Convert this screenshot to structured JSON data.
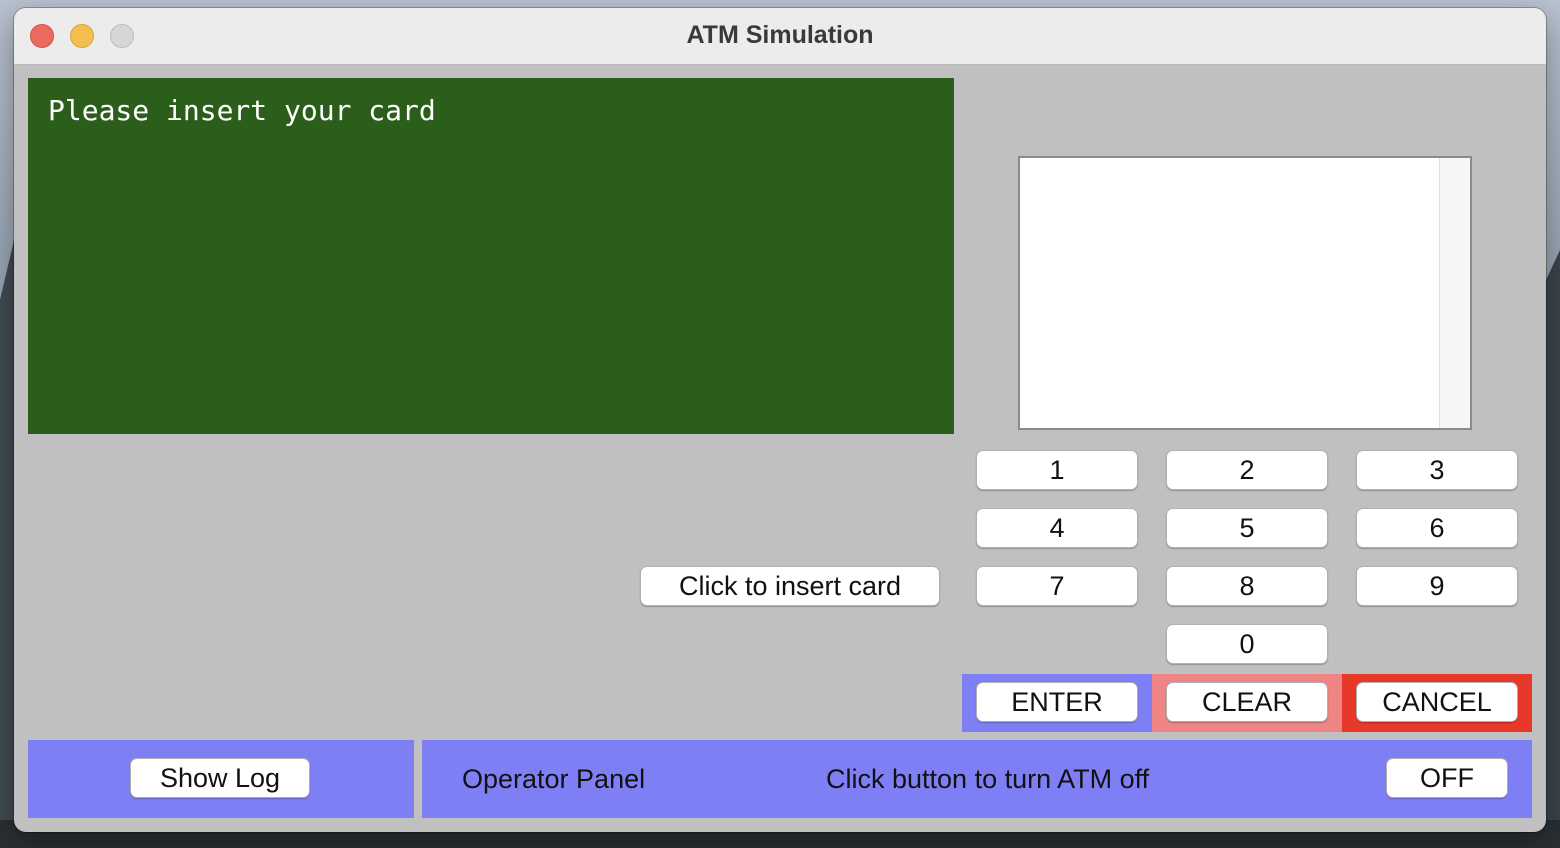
{
  "window": {
    "title": "ATM Simulation"
  },
  "display": {
    "message": "Please insert your card"
  },
  "card_slot": {
    "button_label": "Click to insert card"
  },
  "keypad": {
    "keys": [
      "1",
      "2",
      "3",
      "4",
      "5",
      "6",
      "7",
      "8",
      "9",
      "0"
    ]
  },
  "function_keys": {
    "enter": "ENTER",
    "clear": "CLEAR",
    "cancel": "CANCEL"
  },
  "log": {
    "button_label": "Show Log"
  },
  "operator_panel": {
    "label": "Operator Panel",
    "status_text": "Click button to turn ATM off",
    "toggle_label": "OFF"
  },
  "colors": {
    "display_bg": "#2b5e1a",
    "panel_blue": "#7f7ff5",
    "clear_pink": "#ef8484",
    "cancel_red": "#e8382a",
    "window_gray": "#c0c0c0"
  }
}
